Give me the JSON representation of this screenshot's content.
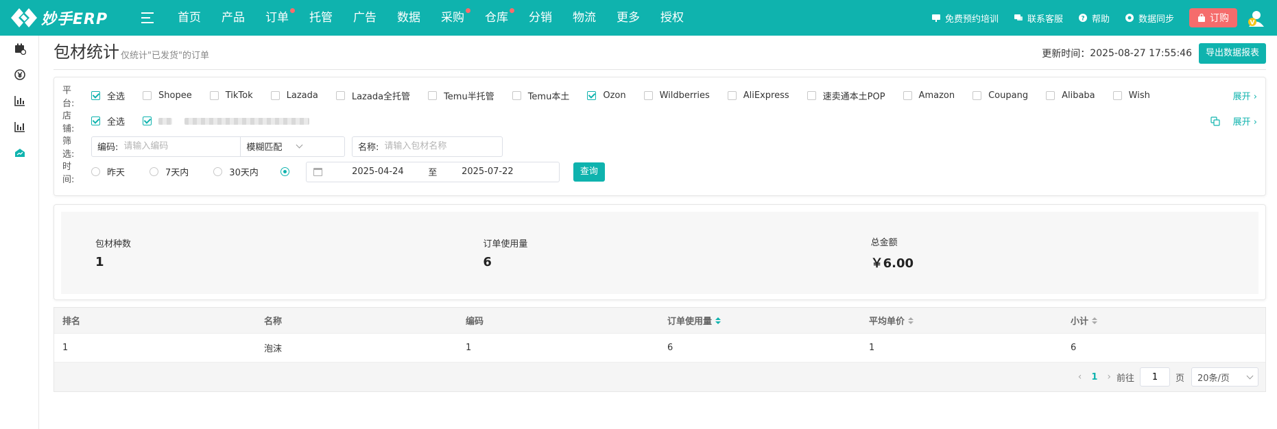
{
  "brand": {
    "name": "妙手ERP",
    "accent": "#0fb3ae",
    "badge_color": "#ff6b6b",
    "order_color": "#f56c6c"
  },
  "nav": [
    {
      "label": "首页",
      "dot": false
    },
    {
      "label": "产品",
      "dot": false
    },
    {
      "label": "订单",
      "dot": true
    },
    {
      "label": "托管",
      "dot": false
    },
    {
      "label": "广告",
      "dot": false
    },
    {
      "label": "数据",
      "dot": false
    },
    {
      "label": "采购",
      "dot": true
    },
    {
      "label": "仓库",
      "dot": true
    },
    {
      "label": "分销",
      "dot": false
    },
    {
      "label": "物流",
      "dot": false
    },
    {
      "label": "更多",
      "dot": false
    },
    {
      "label": "授权",
      "dot": false
    }
  ],
  "top_links": {
    "training": "免费预约培训",
    "service": "联系客服",
    "help": "帮助",
    "sync": "数据同步",
    "order": "订购"
  },
  "sidebar": [
    "calendar-icon",
    "yuan-icon",
    "bar-chart-icon",
    "bar-chart-2-icon",
    "shop-chart-icon"
  ],
  "page": {
    "title": "包材统计",
    "subtitle": "仅统计\"已发货\"的订单",
    "update_label": "更新时间：",
    "update_time": "2025-08-27 17:55:46",
    "export_label": "导出数据报表"
  },
  "filters": {
    "platform_label": "平台:",
    "platforms": [
      {
        "label": "全选",
        "checked": true
      },
      {
        "label": "Shopee",
        "checked": false
      },
      {
        "label": "TikTok",
        "checked": false
      },
      {
        "label": "Lazada",
        "checked": false
      },
      {
        "label": "Lazada全托管",
        "checked": false
      },
      {
        "label": "Temu半托管",
        "checked": false
      },
      {
        "label": "Temu本土",
        "checked": false
      },
      {
        "label": "Ozon",
        "checked": true
      },
      {
        "label": "Wildberries",
        "checked": false
      },
      {
        "label": "AliExpress",
        "checked": false
      },
      {
        "label": "速卖通本土POP",
        "checked": false
      },
      {
        "label": "Amazon",
        "checked": false
      },
      {
        "label": "Coupang",
        "checked": false
      },
      {
        "label": "Alibaba",
        "checked": false
      },
      {
        "label": "Wish",
        "checked": false
      }
    ],
    "expand_label": "展开",
    "shop_label": "店铺:",
    "shop_all": "全选",
    "filter_label": "筛选:",
    "code_label": "编码:",
    "code_placeholder": "请输入编码",
    "match_mode": "模糊匹配",
    "name_label": "名称:",
    "name_placeholder": "请输入包材名称",
    "time_label": "时间:",
    "time_options": [
      "昨天",
      "7天内",
      "30天内"
    ],
    "date_start": "2025-04-24",
    "date_sep": "至",
    "date_end": "2025-07-22",
    "query_label": "查询"
  },
  "stats": [
    {
      "label": "包材种数",
      "value": "1"
    },
    {
      "label": "订单使用量",
      "value": "6"
    },
    {
      "label": "总金额",
      "value": "￥6.00"
    }
  ],
  "table": {
    "columns": [
      "排名",
      "名称",
      "编码",
      "订单使用量",
      "平均单价",
      "小计"
    ],
    "rows": [
      [
        "1",
        "泡沫",
        "1",
        "6",
        "1",
        "6"
      ]
    ]
  },
  "pagination": {
    "current": "1",
    "goto_label": "前往",
    "goto_value": "1",
    "page_unit": "页",
    "page_size": "20条/页"
  }
}
